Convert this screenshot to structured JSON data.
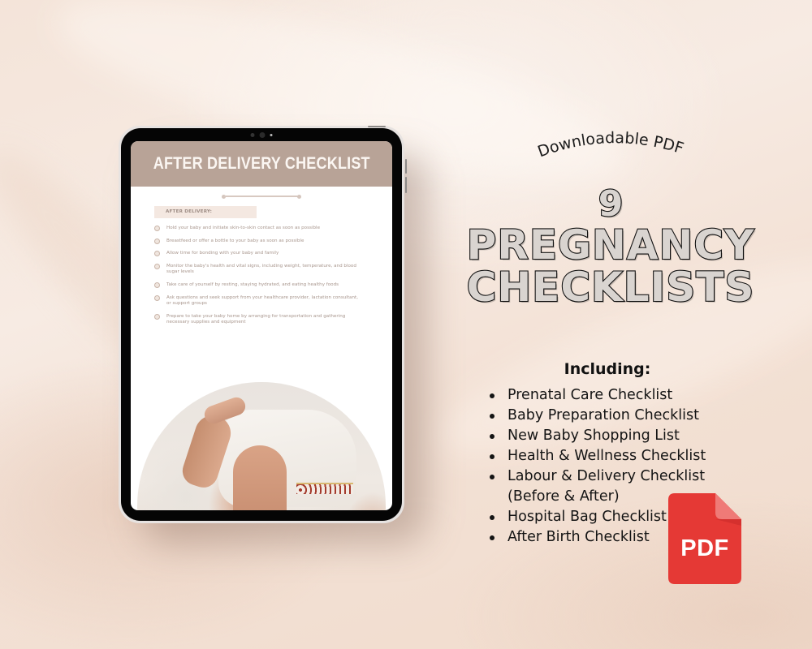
{
  "tablet": {
    "screen": {
      "title": "AFTER DELIVERY CHECKLIST",
      "section_label": "AFTER DELIVERY:",
      "checklist": [
        "Hold your baby and initiate skin-to-skin contact as soon as possible",
        "Breastfeed or offer a bottle to your baby as soon as possible",
        "Allow time for bonding with your baby and family",
        "Monitor the baby's health and vital signs, including weight, temperature, and blood sugar levels",
        "Take care of yourself by resting, staying hydrated, and eating healthy foods",
        "Ask questions and seek support from your healthcare provider, lactation consultant, or support groups",
        "Prepare to take your baby home by arranging for transportation and gathering necessary supplies and equipment"
      ],
      "photo_description": "newborn baby in white onesie held by parent's hand",
      "header_color": "#b8a397"
    }
  },
  "promo": {
    "curved_title": "Downloadable PDF",
    "headline": {
      "number": "9",
      "line1": "PREGNANCY",
      "line2": "CHECKLISTS"
    },
    "including_title": "Including:",
    "items": [
      {
        "text": "Prenatal Care Checklist",
        "bullet": true
      },
      {
        "text": "Baby Preparation Checklist",
        "bullet": true
      },
      {
        "text": "New Baby Shopping List",
        "bullet": true
      },
      {
        "text": "Health & Wellness Checklist",
        "bullet": true
      },
      {
        "text": "Labour & Delivery Checklist",
        "bullet": true
      },
      {
        "text": "(Before & After)",
        "bullet": false
      },
      {
        "text": "Hospital Bag Checklist",
        "bullet": true
      },
      {
        "text": "After Birth Checklist",
        "bullet": true
      }
    ]
  },
  "pdf_icon": {
    "label": "PDF",
    "color": "#e53935",
    "fold_color": "#ef7a77"
  }
}
